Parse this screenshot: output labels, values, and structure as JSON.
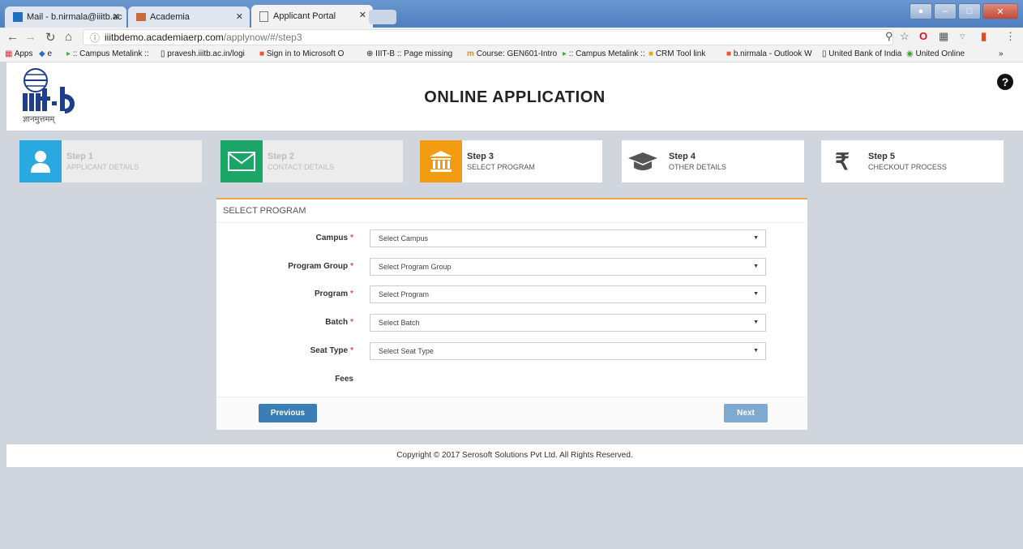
{
  "browser": {
    "tabs": [
      {
        "label": "Mail - b.nirmala@iiitb.ac"
      },
      {
        "label": "Academia"
      },
      {
        "label": "Applicant Portal"
      }
    ],
    "url_host": "iiitbdemo.academiaerp.com",
    "url_path": "/applynow/#/step3",
    "bookmarks": [
      "Apps",
      "e",
      ":: Campus Metalink ::",
      "pravesh.iiitb.ac.in/logi",
      "Sign in to Microsoft O",
      "IIIT-B :: Page missing",
      "Course: GEN601-Intro",
      ":: Campus Metalink ::",
      "CRM Tool link",
      "b.nirmala - Outlook W",
      "United Bank of India",
      "United Online",
      "»"
    ]
  },
  "header": {
    "logo_subtext": "ज्ञानमुत्तमम्",
    "title": "ONLINE APPLICATION",
    "help": "?"
  },
  "steps": [
    {
      "title": "Step 1",
      "subtitle": "APPLICANT DETAILS",
      "color": "#29a9e0",
      "state": "done"
    },
    {
      "title": "Step 2",
      "subtitle": "CONTACT DETAILS",
      "color": "#1aa667",
      "state": "done"
    },
    {
      "title": "Step 3",
      "subtitle": "SELECT PROGRAM",
      "color": "#f39c12",
      "state": "active"
    },
    {
      "title": "Step 4",
      "subtitle": "OTHER DETAILS",
      "color": "#555555",
      "state": "pending"
    },
    {
      "title": "Step 5",
      "subtitle": "CHECKOUT PROCESS",
      "color": "#555555",
      "state": "pending"
    }
  ],
  "form": {
    "heading": "SELECT PROGRAM",
    "fields": [
      {
        "label": "Campus",
        "placeholder": "Select Campus",
        "required": true
      },
      {
        "label": "Program Group",
        "placeholder": "Select Program Group",
        "required": true
      },
      {
        "label": "Program",
        "placeholder": "Select Program",
        "required": true
      },
      {
        "label": "Batch",
        "placeholder": "Select Batch",
        "required": true
      },
      {
        "label": "Seat Type",
        "placeholder": "Select Seat Type",
        "required": true
      }
    ],
    "fees_label": "Fees",
    "required_mark": "*",
    "previous_label": "Previous",
    "next_label": "Next"
  },
  "footer": {
    "copyright": "Copyright © 2017 Serosoft Solutions Pvt Ltd. All Rights Reserved."
  }
}
